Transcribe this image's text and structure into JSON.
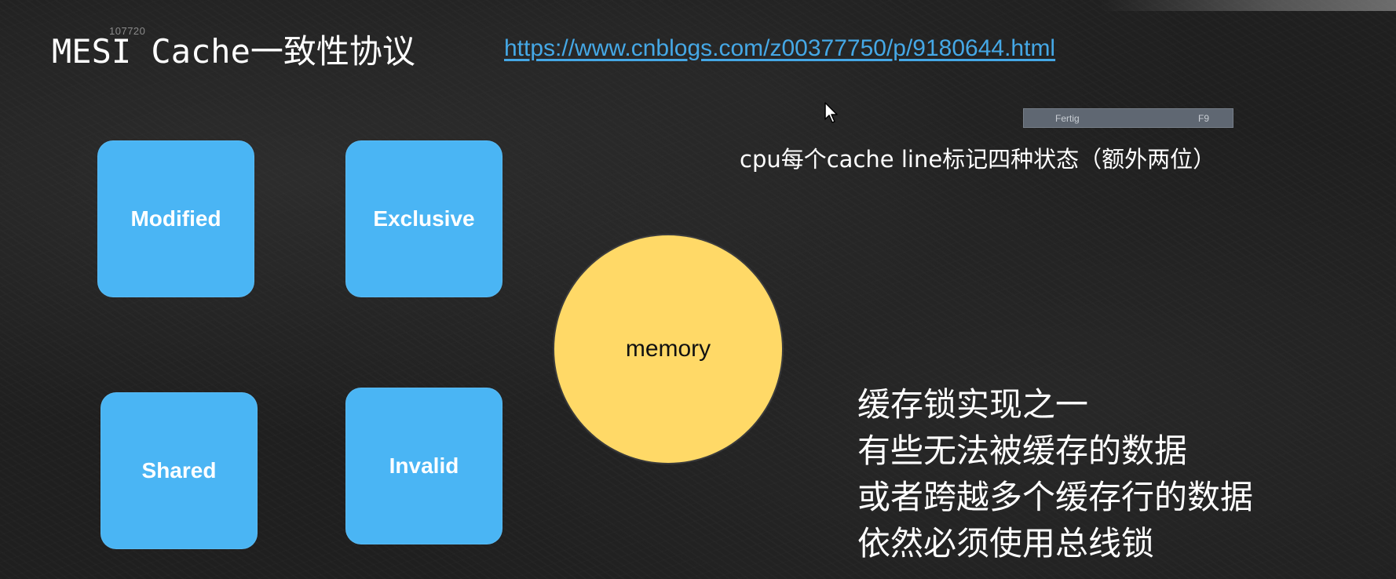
{
  "slide": {
    "frame_id": "107720",
    "title_prefix": "MESI Cache",
    "title_suffix": "一致性协议",
    "link_text": "https://www.cnblogs.com/z00377750/p/9180644.html"
  },
  "overlay": {
    "status_left": "Fertig",
    "status_right": "F9"
  },
  "note": "cpu每个cache line标记四种状态（额外两位）",
  "states": {
    "modified": "Modified",
    "exclusive": "Exclusive",
    "shared": "Shared",
    "invalid": "Invalid"
  },
  "memory_label": "memory",
  "description": [
    "缓存锁实现之一",
    "有些无法被缓存的数据",
    "或者跨越多个缓存行的数据",
    "依然必须使用总线锁"
  ],
  "colors": {
    "background": "#1f1f1f",
    "state_box": "#4ab5f4",
    "memory": "#ffd967",
    "link": "#45a8e6"
  },
  "icons": {
    "cursor": "mouse-pointer-icon"
  }
}
